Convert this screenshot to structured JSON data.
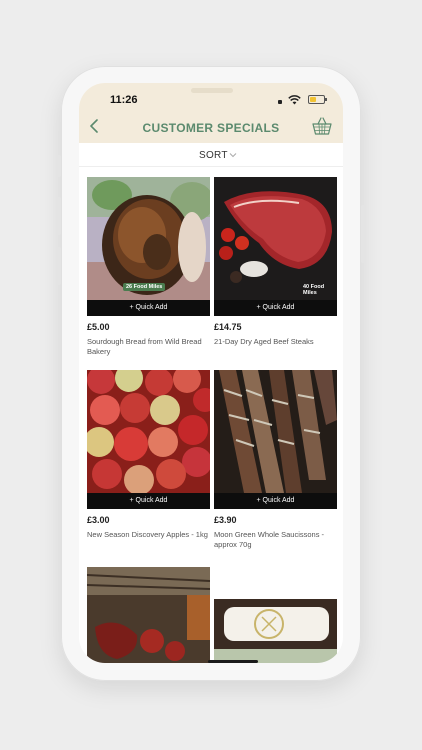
{
  "status_bar": {
    "time": "11:26"
  },
  "header": {
    "title": "CUSTOMER SPECIALS"
  },
  "sort": {
    "label": "SORT"
  },
  "products": [
    {
      "price": "£5.00",
      "name": "Sourdough Bread from Wild Bread Bakery",
      "quick_add": "+ Quick Add",
      "badge": "26 Food Miles"
    },
    {
      "price": "£14.75",
      "name": "21-Day Dry Aged Beef Steaks",
      "quick_add": "+ Quick Add",
      "badge": "40 Food Miles"
    },
    {
      "price": "£3.00",
      "name": "New Season Discovery Apples - 1kg",
      "quick_add": "+ Quick Add"
    },
    {
      "price": "£3.90",
      "name": "Moon Green Whole Saucissons - approx 70g",
      "quick_add": "+ Quick Add"
    }
  ],
  "colors": {
    "header_bg": "#f3ebdb",
    "title_green": "#5b8a6e",
    "quick_add_bg": "#0d0d0d"
  },
  "icons": [
    "back-chevron-icon",
    "basket-icon",
    "chevron-down-icon",
    "wifi-icon",
    "battery-icon"
  ]
}
